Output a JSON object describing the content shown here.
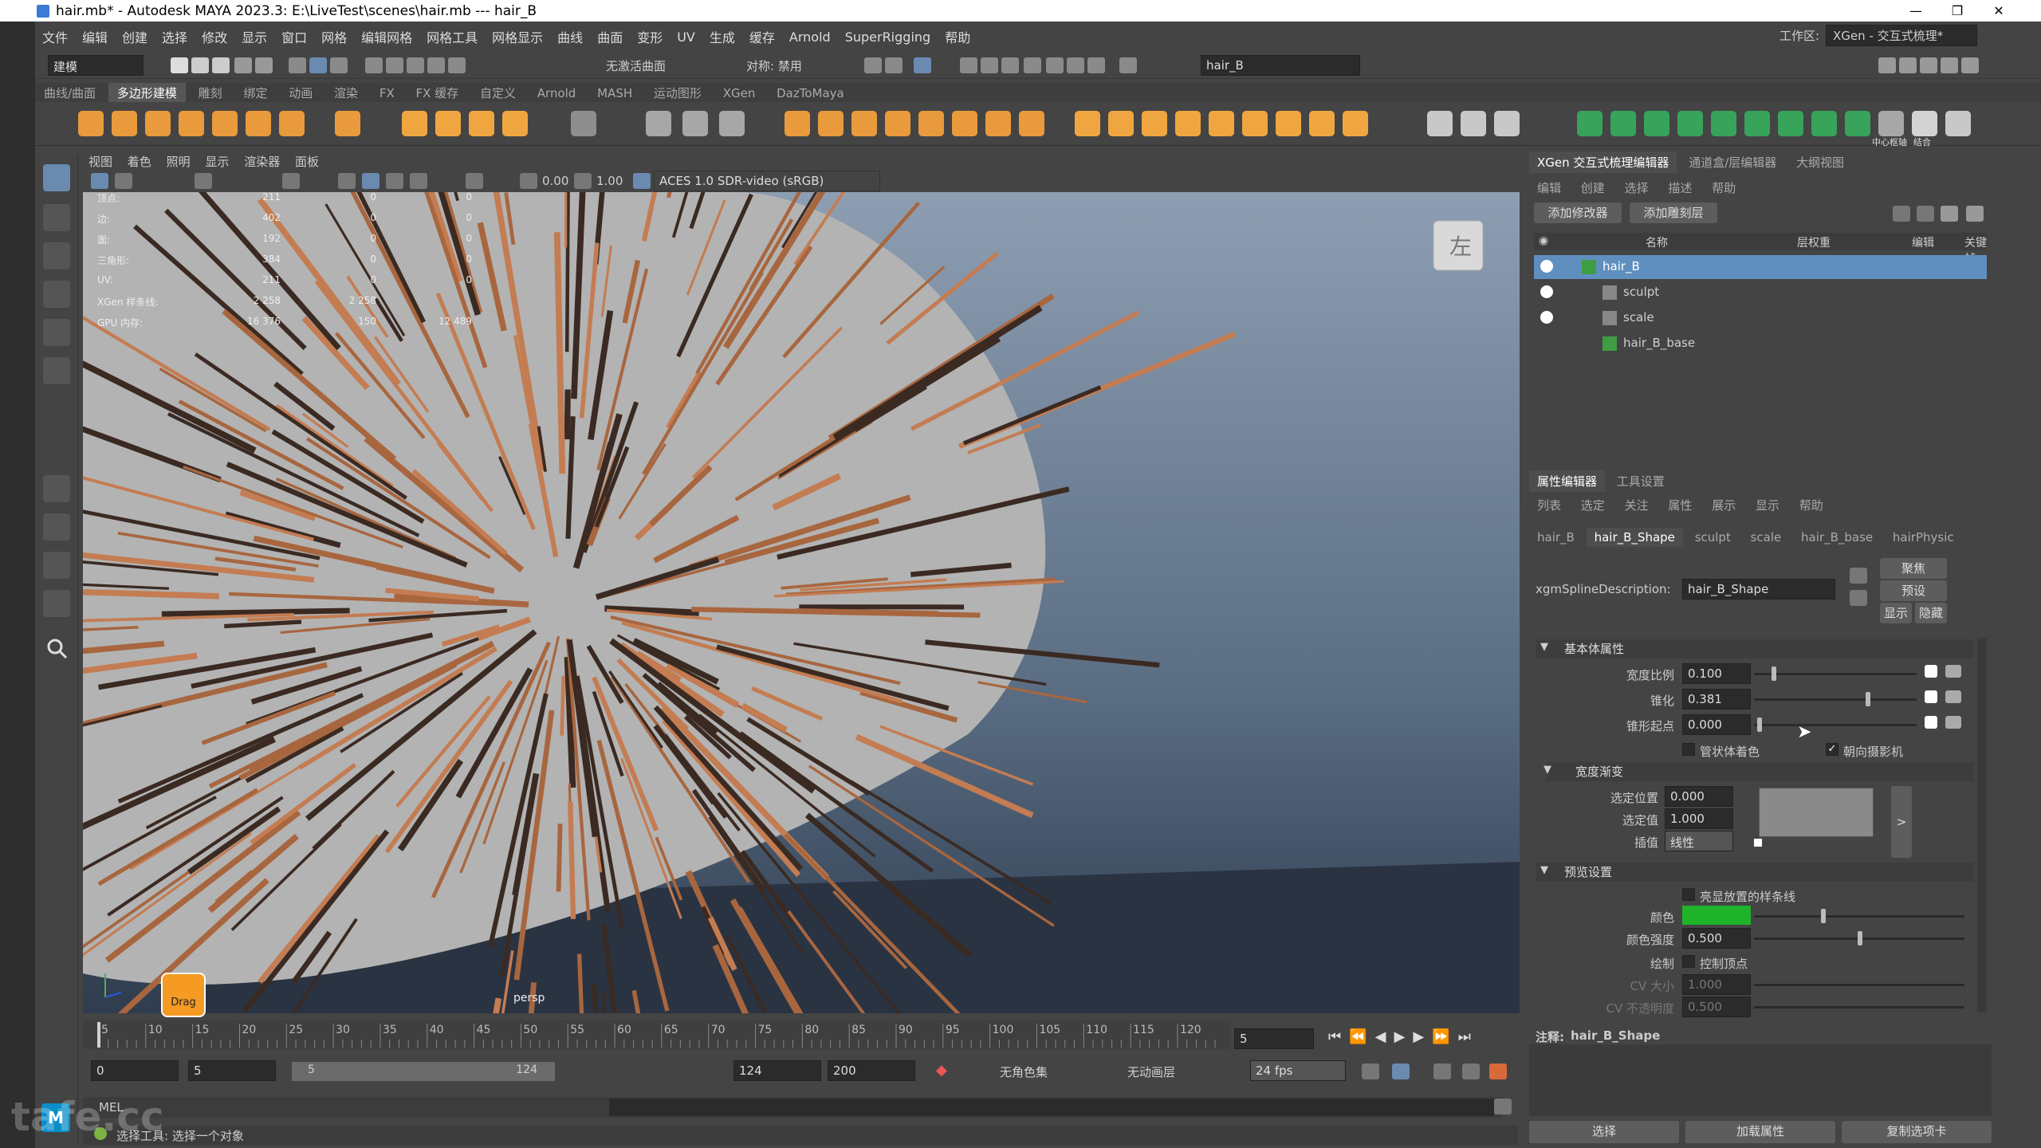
{
  "titlebar": {
    "title": "hair.mb* - Autodesk MAYA 2023.3: E:\\LiveTest\\scenes\\hair.mb   ---   hair_B",
    "minimize": "—",
    "maximize": "❐",
    "close": "✕"
  },
  "menubar": {
    "items": [
      "文件",
      "编辑",
      "创建",
      "选择",
      "修改",
      "显示",
      "窗口",
      "网格",
      "编辑网格",
      "网格工具",
      "网格显示",
      "曲线",
      "曲面",
      "变形",
      "UV",
      "生成",
      "缓存",
      "Arnold",
      "SuperRigging",
      "帮助"
    ],
    "workspace_label": "工作区:",
    "workspace_value": "XGen - 交互式梳理*"
  },
  "statusline": {
    "mode": "建模",
    "no_live_surface": "无激活曲面",
    "symmetry": "对称: 禁用",
    "object_name": "hair_B"
  },
  "shelf": {
    "tabs": [
      "曲线/曲面",
      "多边形建模",
      "雕刻",
      "绑定",
      "动画",
      "渲染",
      "FX",
      "FX 缓存",
      "自定义",
      "Arnold",
      "MASH",
      "运动图形",
      "XGen",
      "DazToMaya"
    ],
    "active_tab": "多边形建模",
    "center_pivot_label": "中心枢轴",
    "unite_label": "结合"
  },
  "viewport": {
    "menu": [
      "视图",
      "着色",
      "照明",
      "显示",
      "渲染器",
      "面板"
    ],
    "exposure": "0.00",
    "gamma": "1.00",
    "colorspace": "ACES 1.0 SDR-video (sRGB)",
    "camera_label": "persp",
    "viewcube_label": "左",
    "drag_label": "Drag",
    "hud": [
      {
        "label": "顶点:",
        "v1": "211",
        "v2": "0",
        "v3": "0"
      },
      {
        "label": "边:",
        "v1": "402",
        "v2": "0",
        "v3": "0"
      },
      {
        "label": "面:",
        "v1": "192",
        "v2": "0",
        "v3": "0"
      },
      {
        "label": "三角形:",
        "v1": "384",
        "v2": "0",
        "v3": "0"
      },
      {
        "label": "UV:",
        "v1": "211",
        "v2": "0",
        "v3": "0"
      },
      {
        "label": "XGen 样条线:",
        "v1": "2 258",
        "v2": "2 258",
        "v3": ""
      },
      {
        "label": "GPU 内存:",
        "v1": "16 376",
        "v2": "150",
        "v3": "12 489"
      }
    ]
  },
  "xgen_editor": {
    "tabs": [
      "XGen 交互式梳理编辑器",
      "通道盒/层编辑器",
      "大纲视图"
    ],
    "menu": [
      "编辑",
      "创建",
      "选择",
      "描述",
      "帮助"
    ],
    "add_modifier": "添加修改器",
    "add_sculpt_layer": "添加雕刻层",
    "columns": [
      "名称",
      "层权重",
      "编辑",
      "关键帧"
    ],
    "tree": [
      {
        "name": "hair_B",
        "icon": "xgen-description-icon",
        "selected": true
      },
      {
        "name": "sculpt",
        "icon": "sculpt-icon",
        "selected": false
      },
      {
        "name": "scale",
        "icon": "scale-icon",
        "selected": false
      },
      {
        "name": "hair_B_base",
        "icon": "base-icon",
        "selected": false
      }
    ]
  },
  "attribute_editor": {
    "tabs": [
      "属性编辑器",
      "工具设置"
    ],
    "menu": [
      "列表",
      "选定",
      "关注",
      "属性",
      "展示",
      "显示",
      "帮助"
    ],
    "node_tabs": [
      "hair_B",
      "hair_B_Shape",
      "sculpt",
      "scale",
      "hair_B_base",
      "hairPhysic"
    ],
    "active_node_tab": "hair_B_Shape",
    "description_label": "xgmSplineDescription:",
    "description_value": "hair_B_Shape",
    "focus_btn": "聚焦",
    "preset_btn": "预设",
    "show_btn": "显示",
    "hide_btn": "隐藏",
    "section_basic": "基本体属性",
    "width_scale_label": "宽度比例",
    "width_scale_value": "0.100",
    "taper_label": "锥化",
    "taper_value": "0.381",
    "taper_start_label": "锥形起点",
    "taper_start_value": "0.000",
    "tube_shade_label": "管状体着色",
    "face_camera_label": "朝向摄影机",
    "section_width_ramp": "宽度渐变",
    "selected_pos_label": "选定位置",
    "selected_pos_value": "0.000",
    "selected_val_label": "选定值",
    "selected_val_value": "1.000",
    "interp_label": "插值",
    "interp_value": "线性",
    "section_preview": "预览设置",
    "highlight_label": "亮显放置的样条线",
    "color_label": "颜色",
    "color_swatch": "#1fb32a",
    "color_intensity_label": "颜色强度",
    "color_intensity_value": "0.500",
    "draw_label": "绘制",
    "control_vertex_label": "控制顶点",
    "cv_size_label": "CV 大小",
    "cv_size_value": "1.000",
    "cv_opacity_label": "CV 不透明度",
    "cv_opacity_value": "0.500",
    "note_label": "注释:",
    "note_value": "hair_B_Shape",
    "select_btn": "选择",
    "load_attr_btn": "加载属性",
    "copy_tab_btn": "复制选项卡"
  },
  "timeline": {
    "ticks": [
      "5",
      "10",
      "15",
      "20",
      "25",
      "30",
      "35",
      "40",
      "45",
      "50",
      "55",
      "60",
      "65",
      "70",
      "75",
      "80",
      "85",
      "90",
      "95",
      "100",
      "105",
      "110",
      "115",
      "120"
    ],
    "current_frame": "5",
    "range_start": "0",
    "range_inner_start": "5",
    "slider_start": "5",
    "slider_end": "124",
    "range_inner_end": "124",
    "range_end": "200",
    "char_set": "无角色集",
    "anim_layer": "无动画层",
    "fps": "24 fps"
  },
  "commandline": {
    "lang": "MEL",
    "help": "选择工具: 选择一个对象"
  },
  "watermark": "tafe.cc"
}
